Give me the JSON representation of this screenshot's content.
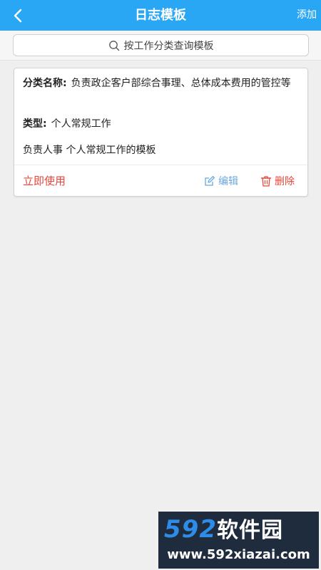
{
  "header": {
    "title": "日志模板",
    "add_label": "添加"
  },
  "search": {
    "placeholder": "按工作分类查询模板"
  },
  "card": {
    "category_label": "分类名称:",
    "category_value": "负责政企客户部综合事理、总体成本费用的管控等",
    "type_label": "类型:",
    "type_value": "个人常规工作",
    "description": "负责人事 个人常规工作的模板",
    "use_label": "立即使用",
    "edit_label": "编辑",
    "delete_label": "删除"
  },
  "watermark": {
    "brand_digits": "592",
    "brand_text": "软件园",
    "url": "www.592xiazai.com"
  },
  "colors": {
    "header": "#29a7f5",
    "danger": "#e8463b",
    "link": "#6aa8df"
  }
}
